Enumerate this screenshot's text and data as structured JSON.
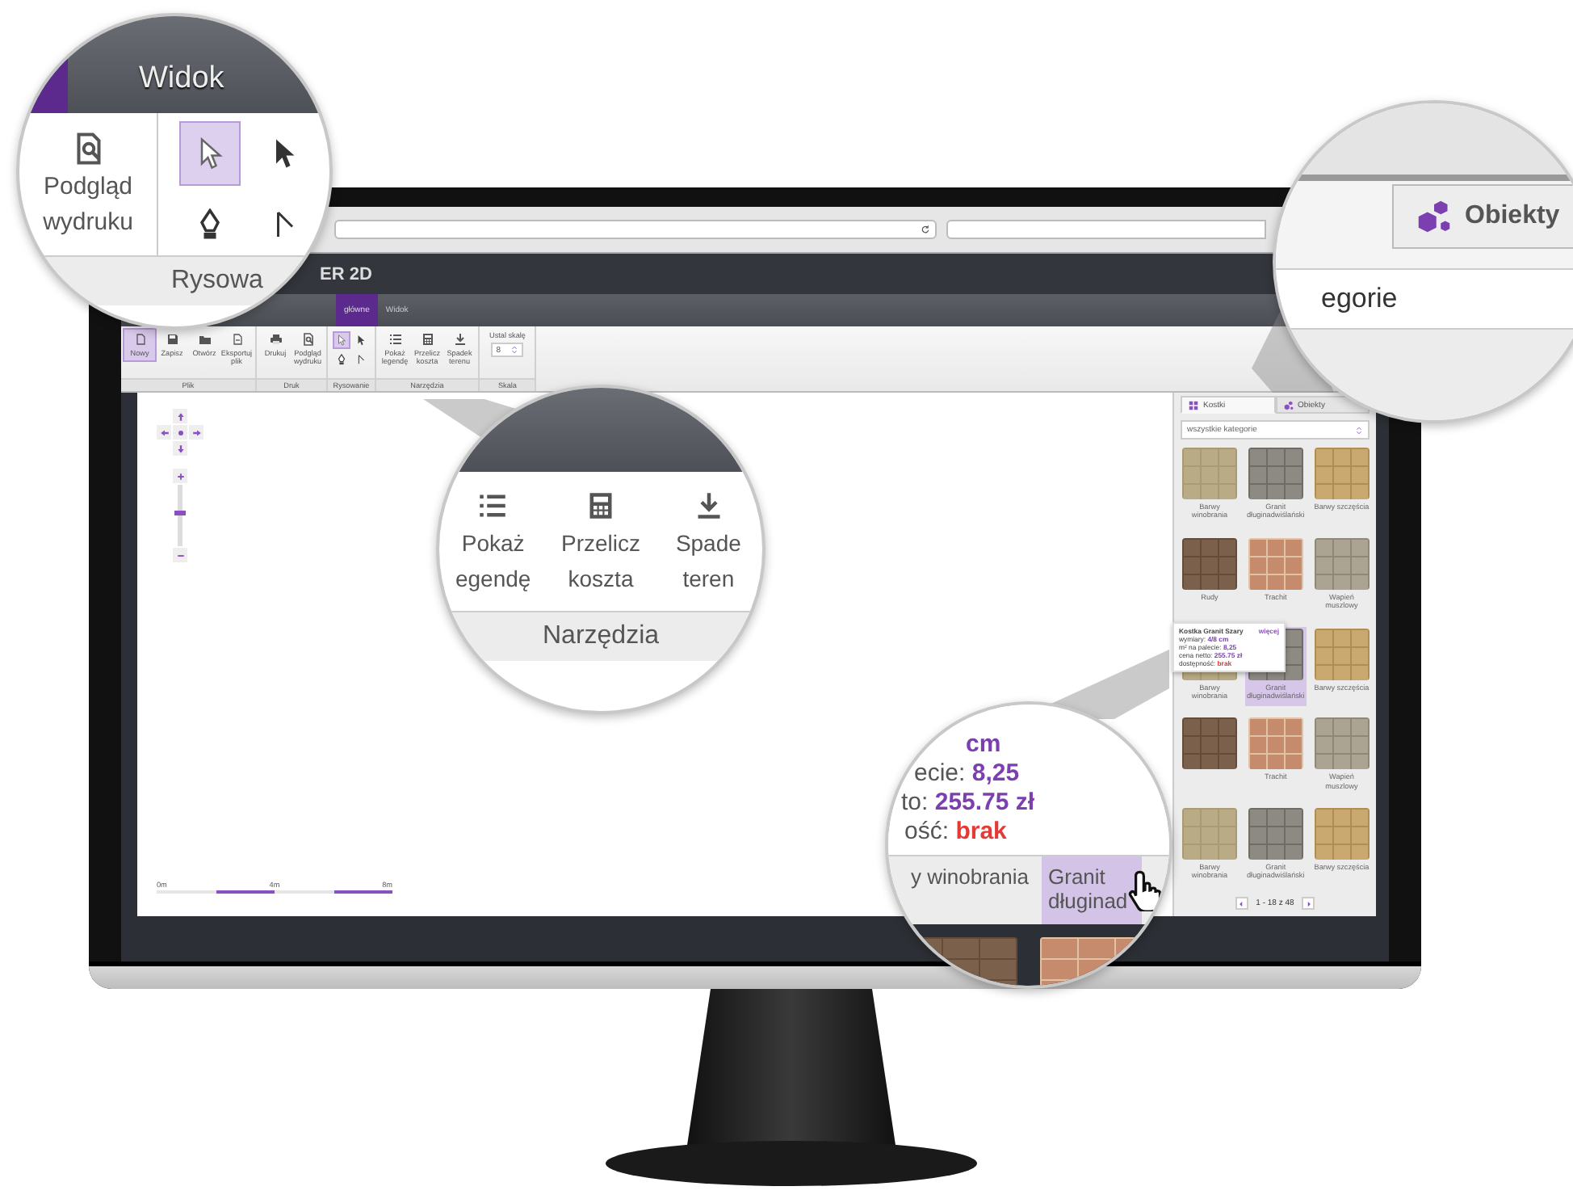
{
  "app_title": "ER 2D",
  "tabs": [
    {
      "label": "główne",
      "selected": true
    },
    {
      "label": "Widok",
      "selected": false
    }
  ],
  "ribbon": {
    "groups": [
      {
        "label": "Plik",
        "items": [
          {
            "kind": "button",
            "label": "Nowy",
            "selected": true
          },
          {
            "kind": "button",
            "label": "Zapisz",
            "selected": false
          },
          {
            "kind": "button",
            "label": "Otwórz",
            "selected": false
          },
          {
            "kind": "button",
            "label": "Eksportuj plik",
            "selected": false
          }
        ]
      },
      {
        "label": "Druk",
        "items": [
          {
            "kind": "button",
            "label": "Drukuj",
            "selected": false
          },
          {
            "kind": "button",
            "label": "Podgląd wydruku",
            "selected": false
          }
        ]
      },
      {
        "label": "Rysowanie",
        "items": [
          {
            "kind": "tool",
            "selected": true
          },
          {
            "kind": "tool",
            "selected": false
          },
          {
            "kind": "tool",
            "selected": false
          },
          {
            "kind": "tool",
            "selected": false
          }
        ]
      },
      {
        "label": "Narzędzia",
        "items": [
          {
            "kind": "button",
            "label": "Pokaż legendę",
            "selected": false
          },
          {
            "kind": "button",
            "label": "Przelicz koszta",
            "selected": false
          },
          {
            "kind": "button",
            "label": "Spadek terenu",
            "selected": false
          }
        ]
      },
      {
        "label": "Skala",
        "items": [
          {
            "kind": "spinner",
            "label": "Ustal skalę",
            "value": "8"
          }
        ]
      }
    ]
  },
  "canvas": {
    "zoom_slider": {
      "level": 0.55
    },
    "scale_labels": [
      "0m",
      "4m",
      "8m"
    ]
  },
  "sidebar": {
    "tabs": [
      {
        "label": "Kostki",
        "selected": true
      },
      {
        "label": "Obiekty",
        "selected": false
      }
    ],
    "category": "wszystkie kategorie",
    "tiles": [
      {
        "label": "Barwy winobrania",
        "selected": false
      },
      {
        "label": "Granit długinadwiślański",
        "selected": false
      },
      {
        "label": "Barwy szczęścia",
        "selected": false
      },
      {
        "label": "Rudy",
        "selected": false
      },
      {
        "label": "Trachit",
        "selected": false
      },
      {
        "label": "Wapień muszlowy",
        "selected": false
      },
      {
        "label": "Barwy winobrania",
        "selected": false
      },
      {
        "label": "Granit długinadwiślański",
        "selected": true
      },
      {
        "label": "Barwy szczęścia",
        "selected": false
      },
      {
        "selected": false
      },
      {
        "label": "Trachit",
        "selected": false
      },
      {
        "label": "Wapień muszlowy",
        "selected": false
      },
      {
        "label": "Barwy winobrania",
        "selected": false
      },
      {
        "label": "Granit długinadwiślański",
        "selected": false
      },
      {
        "label": "Barwy szczęścia",
        "selected": false
      }
    ],
    "pagination": "1 - 18 z 48"
  },
  "tooltip": {
    "title": "Kostka Granit Szary",
    "more": "więcej",
    "lines": [
      {
        "label": "wymiary:",
        "value": "4/8 cm",
        "kind": "ok"
      },
      {
        "label": "m² na palecie:",
        "value": "8,25",
        "kind": "ok"
      },
      {
        "label": "cena netto:",
        "value": "255.75 zł",
        "kind": "ok"
      },
      {
        "label": "dostępność:",
        "value": "brak",
        "kind": "alert"
      }
    ]
  },
  "lenses": [
    {
      "kind": "view",
      "tab": "Widok",
      "button_lines": [
        "Podgląd",
        "wydruku"
      ],
      "tools": [
        {
          "selected": true
        },
        {
          "selected": false
        },
        {
          "selected": false
        },
        {
          "selected": false
        }
      ],
      "group": "Rysowa"
    },
    {
      "kind": "tools",
      "buttons": [
        {
          "lines": [
            "Pokaż",
            "egendę"
          ]
        },
        {
          "lines": [
            "Przelicz",
            "koszta"
          ]
        },
        {
          "lines": [
            "Spade",
            "teren"
          ]
        }
      ],
      "group": "Narzędzia"
    },
    {
      "kind": "objects",
      "tab": "Obiekty",
      "field": "egorie"
    },
    {
      "kind": "tooltip",
      "lines": [
        {
          "value": "cm",
          "kind": "ok"
        },
        {
          "label": "ecie: ",
          "value": "8,25",
          "kind": "ok"
        },
        {
          "label": "to: ",
          "value": "255.75 zł",
          "kind": "ok"
        },
        {
          "label": "ość: ",
          "value": "brak",
          "kind": "alert"
        }
      ],
      "tiles": [
        {
          "label": "y winobrania",
          "selected": false
        },
        {
          "label": "Granit długinad",
          "selected": true
        }
      ]
    }
  ]
}
